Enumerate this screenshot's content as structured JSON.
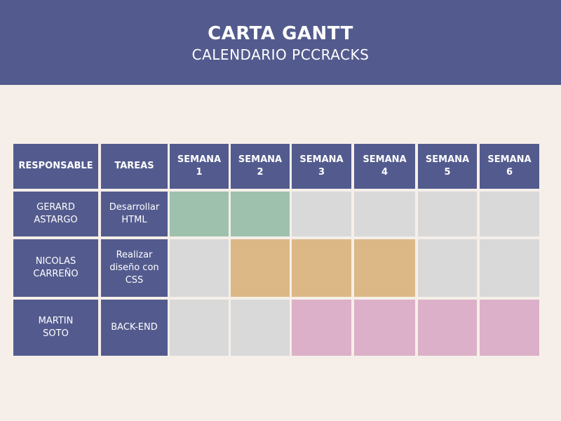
{
  "header": {
    "title": "CARTA GANTT",
    "subtitle": "CALENDARIO PCCRACKS"
  },
  "colors": {
    "header_bg": "#535b8e",
    "page_bg": "#f6efe9",
    "empty": "#d9d9d9",
    "green": "#9dc1ac",
    "orange": "#dcb886",
    "pink": "#dcb0c8"
  },
  "chart_data": {
    "type": "table",
    "columns": [
      "RESPONSABLE",
      "TAREAS",
      "SEMANA 1",
      "SEMANA 2",
      "SEMANA 3",
      "SEMANA 4",
      "SEMANA 5",
      "SEMANA 6"
    ],
    "tasks": [
      {
        "responsable": "GERARD ASTARGO",
        "tarea": "Desarrollar HTML",
        "weeks_active": [
          1,
          2
        ],
        "color": "#9dc1ac"
      },
      {
        "responsable": "NICOLAS CARREÑO",
        "tarea": "Realizar diseño con CSS",
        "weeks_active": [
          2,
          3,
          4
        ],
        "color": "#dcb886"
      },
      {
        "responsable": "MARTIN SOTO",
        "tarea": "BACK-END",
        "weeks_active": [
          3,
          4,
          5,
          6
        ],
        "color": "#dcb0c8"
      }
    ]
  }
}
